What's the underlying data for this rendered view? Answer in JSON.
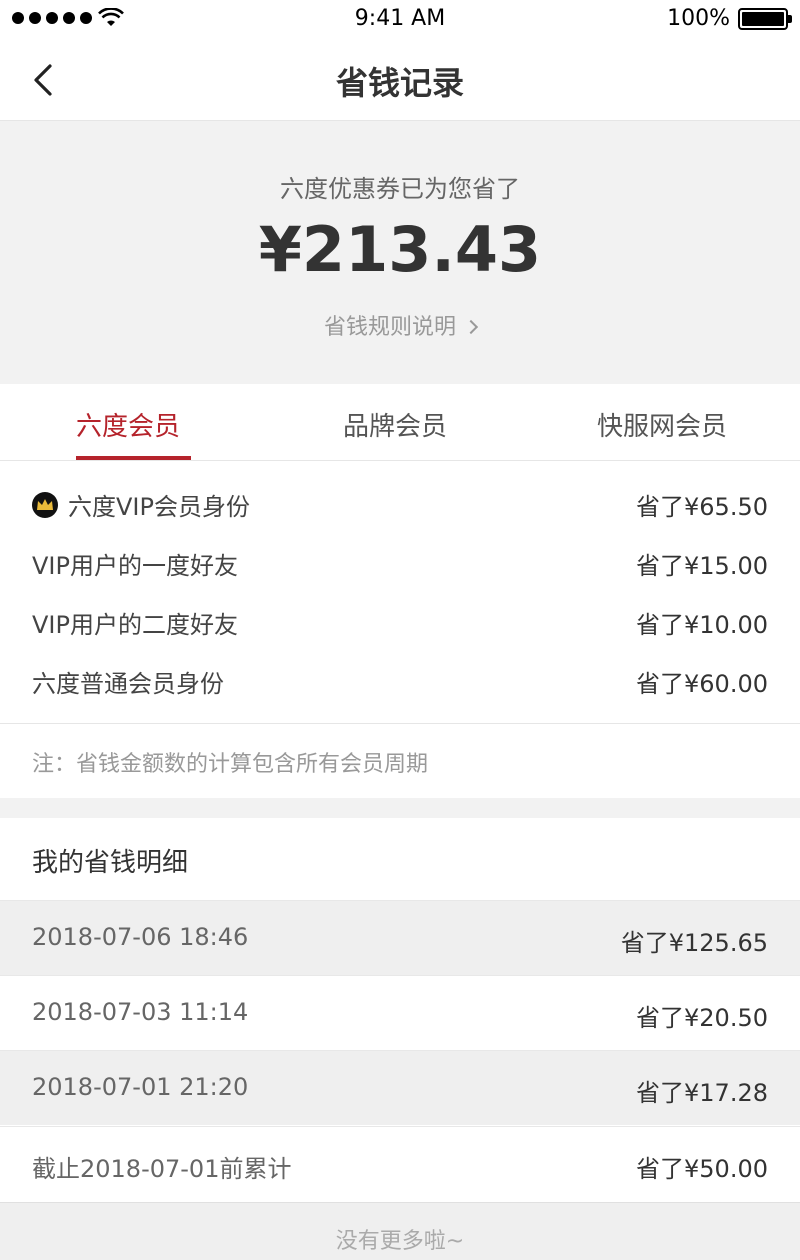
{
  "status_bar": {
    "time": "9:41 AM",
    "battery": "100%"
  },
  "nav": {
    "title": "省钱记录"
  },
  "summary": {
    "caption": "六度优惠券已为您省了",
    "amount": "¥213.43",
    "rule_link": "省钱规则说明"
  },
  "tabs": [
    {
      "label": "六度会员",
      "active": true
    },
    {
      "label": "品牌会员",
      "active": false
    },
    {
      "label": "快服网会员",
      "active": false
    }
  ],
  "breakdown": [
    {
      "label": "六度VIP会员身份",
      "value": "省了¥65.50",
      "icon": "crown-icon"
    },
    {
      "label": "VIP用户的一度好友",
      "value": "省了¥15.00"
    },
    {
      "label": "VIP用户的二度好友",
      "value": "省了¥10.00"
    },
    {
      "label": "六度普通会员身份",
      "value": "省了¥60.00"
    }
  ],
  "note": "注：省钱金额数的计算包含所有会员周期",
  "detail": {
    "title": "我的省钱明细",
    "rows": [
      {
        "date": "2018-07-06 18:46",
        "amount": "省了¥125.65"
      },
      {
        "date": "2018-07-03 11:14",
        "amount": "省了¥20.50"
      },
      {
        "date": "2018-07-01 21:20",
        "amount": "省了¥17.28"
      },
      {
        "date": "截止2018-07-01前累计",
        "amount": "省了¥50.00"
      }
    ]
  },
  "footer": "没有更多啦~",
  "colors": {
    "accent": "#b5232b",
    "background_gray": "#f2f2f2"
  }
}
